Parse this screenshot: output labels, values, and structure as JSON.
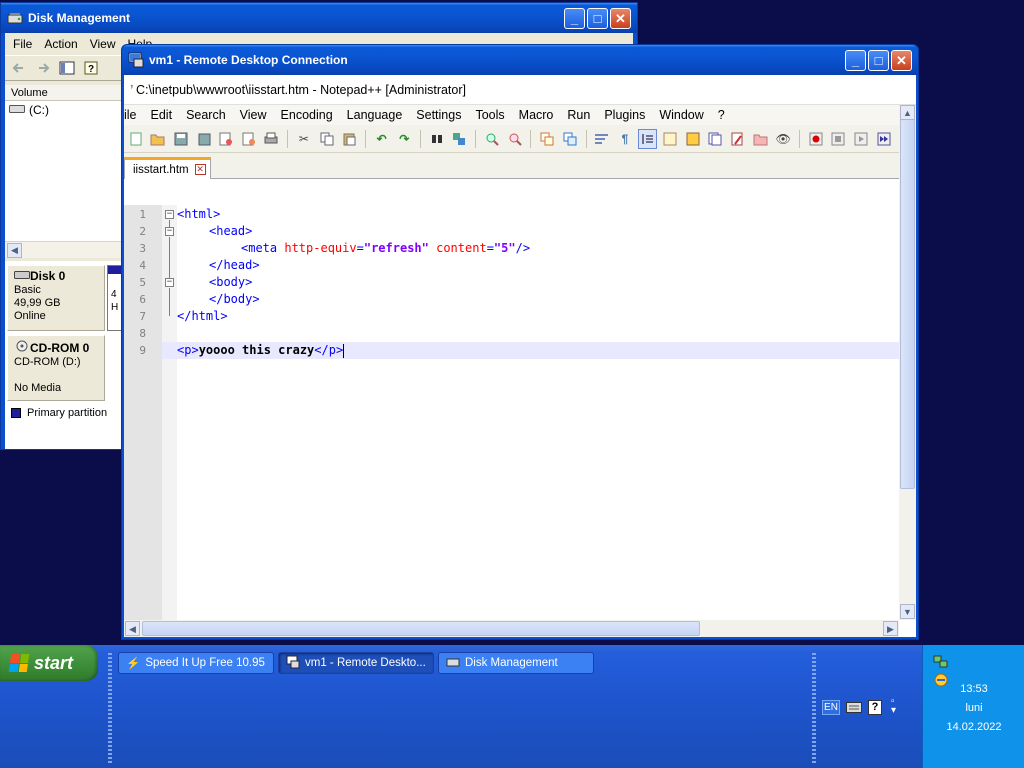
{
  "disk_management": {
    "title": "Disk Management",
    "menu": [
      "File",
      "Action",
      "View",
      "Help"
    ],
    "volume_header": "Volume",
    "volume_item": "(C:)",
    "disk0": {
      "name": "Disk 0",
      "type": "Basic",
      "size": "49,99 GB",
      "status": "Online"
    },
    "cdrom0": {
      "name": "CD-ROM 0",
      "drive": "CD-ROM (D:)",
      "media": "No Media"
    },
    "strip_peek": [
      "4",
      "H"
    ],
    "legend": "Primary partition"
  },
  "rdp": {
    "title": "vm1 - Remote Desktop Connection"
  },
  "notepadpp": {
    "title": "C:\\inetpub\\wwwroot\\iisstart.htm - Notepad++ [Administrator]",
    "menu": [
      "ile",
      "Edit",
      "Search",
      "View",
      "Encoding",
      "Language",
      "Settings",
      "Tools",
      "Macro",
      "Run",
      "Plugins",
      "Window",
      "?"
    ],
    "tab_name": "iisstart.htm",
    "line_numbers": [
      "1",
      "2",
      "3",
      "4",
      "5",
      "6",
      "7",
      "8",
      "9"
    ],
    "code": {
      "l1_tag": "<html>",
      "l2_tag": "<head>",
      "l3_open": "<meta ",
      "l3_attr1": "http-equiv",
      "l3_eq1": "=",
      "l3_val1": "\"refresh\"",
      "l3_attr2": "content",
      "l3_eq2": "=",
      "l3_val2": "\"5\"",
      "l3_close": "/>",
      "l4_tag": "</head>",
      "l5_tag": "<body>",
      "l6_tag": "</body>",
      "l7_tag": "</html>",
      "l9_open": "<p>",
      "l9_text": "yoooo this crazy",
      "l9_close": "</p>"
    }
  },
  "taskbar": {
    "start_label": "start",
    "buttons": [
      {
        "label": "Speed It Up Free 10.95"
      },
      {
        "label": "vm1 - Remote Deskto..."
      },
      {
        "label": "Disk Management"
      }
    ],
    "lang": "EN",
    "clock": {
      "time": "13:53",
      "day": "luni",
      "date": "14.02.2022"
    }
  },
  "colors": {
    "desktop": "#0b0c4a",
    "xp_blue": "#0a5ad8",
    "tag_blue": "#0000ff",
    "attr_red": "#ff0000",
    "value_purple": "#8000ff"
  }
}
